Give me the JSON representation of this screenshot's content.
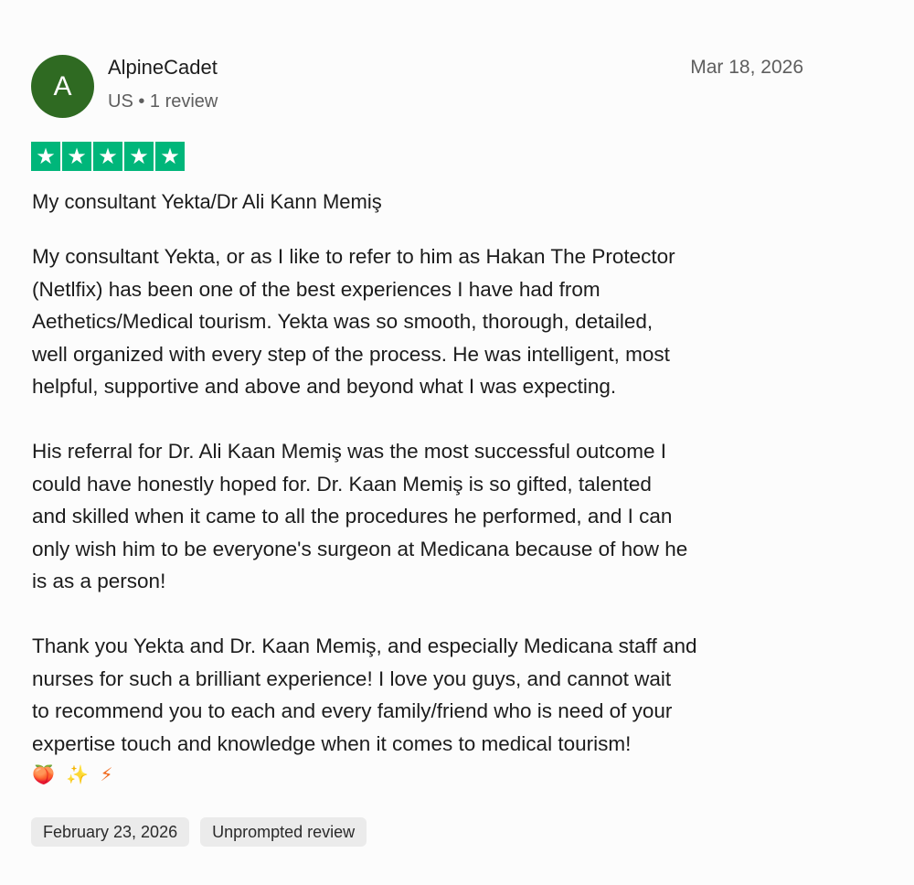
{
  "reviewer": {
    "avatar_letter": "A",
    "name": "AlpineCadet",
    "meta": "US • 1 review",
    "avatar_color": "#2f6a22"
  },
  "review": {
    "date": "Mar 18, 2026",
    "rating": 5,
    "star_color": "#00b67a",
    "stars": [
      "★",
      "★",
      "★",
      "★",
      "★"
    ],
    "title": "My consultant Yekta/Dr Ali Kann Memiş",
    "paragraphs": [
      "My consultant Yekta, or as I like to refer to him as Hakan The Protector\n(Netlfix) has been one of the best experiences I have had from\nAethetics/Medical tourism. Yekta was so smooth, thorough, detailed,\nwell organized with every step of the process. He was intelligent, most\nhelpful, supportive and above and beyond what I was expecting.",
      "His referral for Dr. Ali Kaan Memiş was the most successful outcome I\ncould have honestly hoped for. Dr. Kaan Memiş is so gifted, talented\nand skilled when it came to all the procedures he performed, and I can\nonly wish him to be everyone's surgeon at Medicana because of how he\nis as a person!",
      "Thank you Yekta and Dr. Kaan Memiş, and especially Medicana staff and\nnurses for such a brilliant experience! I love you guys, and cannot wait\nto recommend you to each and every family/friend who is need of your\nexpertise touch and knowledge when it comes to medical tourism!"
    ],
    "emojis": [
      "🍑",
      "✨",
      "⚡"
    ],
    "experience_date": "February 23, 2026",
    "tag": "Unprompted review"
  }
}
